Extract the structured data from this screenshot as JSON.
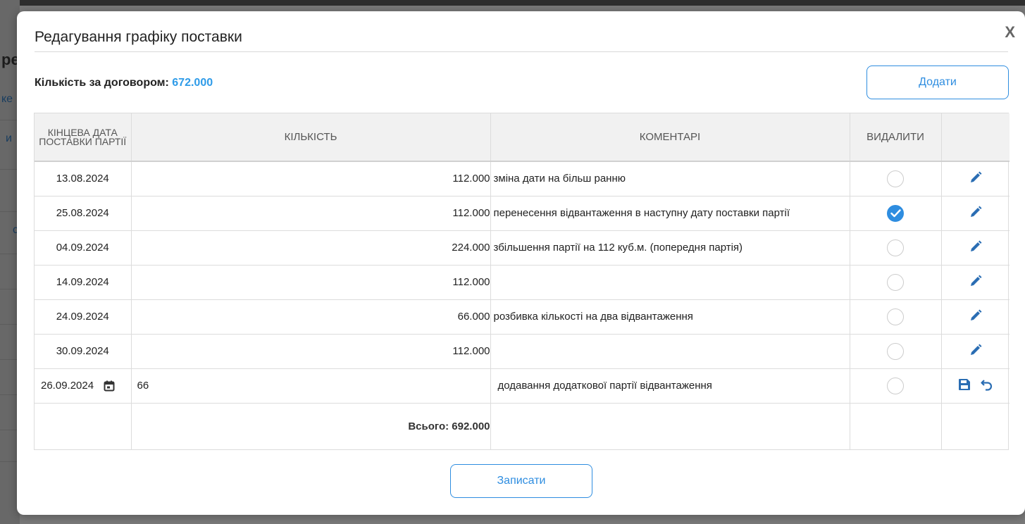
{
  "background": {
    "fragments": [
      "ре",
      "ке",
      "и",
      "с"
    ]
  },
  "modal": {
    "title": "Редагування графіку поставки",
    "close_label": "X",
    "quantity_label": "Кількість за договором:",
    "quantity_value": "672.000",
    "add_button": "Додати",
    "save_button": "Записати"
  },
  "table": {
    "columns": [
      "Кінцева дата поставки партії",
      "Кількість",
      "Коментарі",
      "Видалити",
      ""
    ],
    "rows": [
      {
        "date": "13.08.2024",
        "qty": "112.000",
        "comment": "зміна дати на більш ранню",
        "delete": false
      },
      {
        "date": "25.08.2024",
        "qty": "112.000",
        "comment": "перенесення відвантаження в наступну дату поставки партії",
        "delete": true
      },
      {
        "date": "04.09.2024",
        "qty": "224.000",
        "comment": "збільшення партії на 112 куб.м. (попередня партія)",
        "delete": false
      },
      {
        "date": "14.09.2024",
        "qty": "112.000",
        "comment": "",
        "delete": false
      },
      {
        "date": "24.09.2024",
        "qty": "66.000",
        "comment": "розбивка кількості на два відвантаження",
        "delete": false
      },
      {
        "date": "30.09.2024",
        "qty": "112.000",
        "comment": "",
        "delete": false
      }
    ],
    "edit_row": {
      "date": "26.09.2024",
      "qty": "66",
      "comment": "додавання додаткової  партії відвантаження",
      "delete": false
    },
    "total_label": "Всього: 692.000"
  },
  "icons": {
    "edit": "pencil-icon",
    "calendar": "calendar-icon",
    "save": "floppy-disk-icon",
    "undo": "undo-icon",
    "check": "checkmark-icon"
  },
  "colors": {
    "accent": "#2e8de0",
    "quantity_value": "#2e9be8",
    "icon_blue": "#2a6db3"
  }
}
